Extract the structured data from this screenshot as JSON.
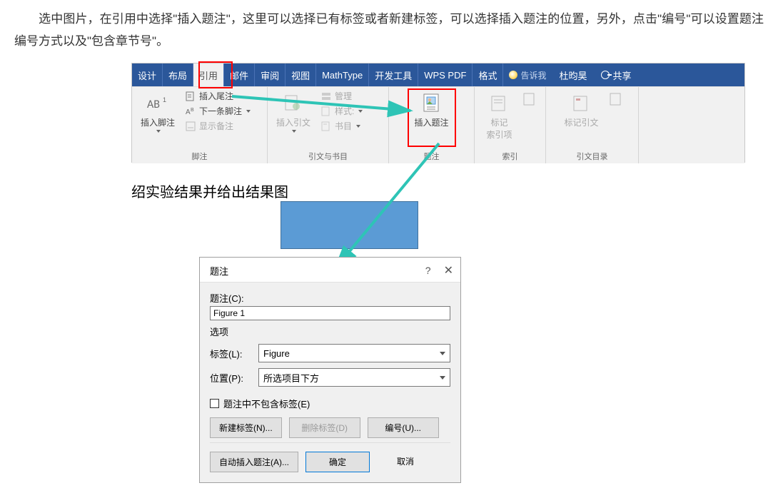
{
  "intro": {
    "text": "　　选中图片，在引用中选择\"插入题注\"，这里可以选择已有标签或者新建标签，可以选择插入题注的位置，另外，点击\"编号\"可以设置题注编号方式以及\"包含章节号\"。"
  },
  "ribbon": {
    "tabs": {
      "design": "设计",
      "layout": "布局",
      "references": "引用",
      "mailings": "邮件",
      "review": "审阅",
      "view": "视图",
      "mathtype": "MathType",
      "devtools": "开发工具",
      "wpspdf": "WPS PDF",
      "format": "格式"
    },
    "tellme": "告诉我",
    "account": "杜昀昊",
    "share": "共享",
    "groups": {
      "footnotes": {
        "insert_footnote": "插入脚注",
        "insert_endnote": "插入尾注",
        "next_footnote": "下一条脚注",
        "show_notes": "显示备注",
        "label": "脚注"
      },
      "citations": {
        "insert_citation": "插入引文",
        "manage": "管理",
        "style": "样式:",
        "bibliography": "书目",
        "label": "引文与书目"
      },
      "captions": {
        "insert_caption": "插入题注",
        "label": "题注"
      },
      "index": {
        "mark_entry": "标记\n索引项",
        "label": "索引"
      },
      "toa": {
        "mark_citation": "标记引文",
        "label": "引文目录"
      }
    }
  },
  "doc": {
    "body_text": "绍实验结果并给出结果图"
  },
  "dialog": {
    "title": "题注",
    "help": "?",
    "close": "✕",
    "caption_label": "题注(C):",
    "caption_value": "Figure 1",
    "options_label": "选项",
    "label_field": "标签(L):",
    "label_value": "Figure",
    "position_field": "位置(P):",
    "position_value": "所选项目下方",
    "exclude_label": "题注中不包含标签(E)",
    "new_label_btn": "新建标签(N)...",
    "delete_label_btn": "删除标签(D)",
    "numbering_btn": "编号(U)...",
    "auto_caption_btn": "自动插入题注(A)...",
    "ok_btn": "确定",
    "cancel_btn": "取消"
  }
}
